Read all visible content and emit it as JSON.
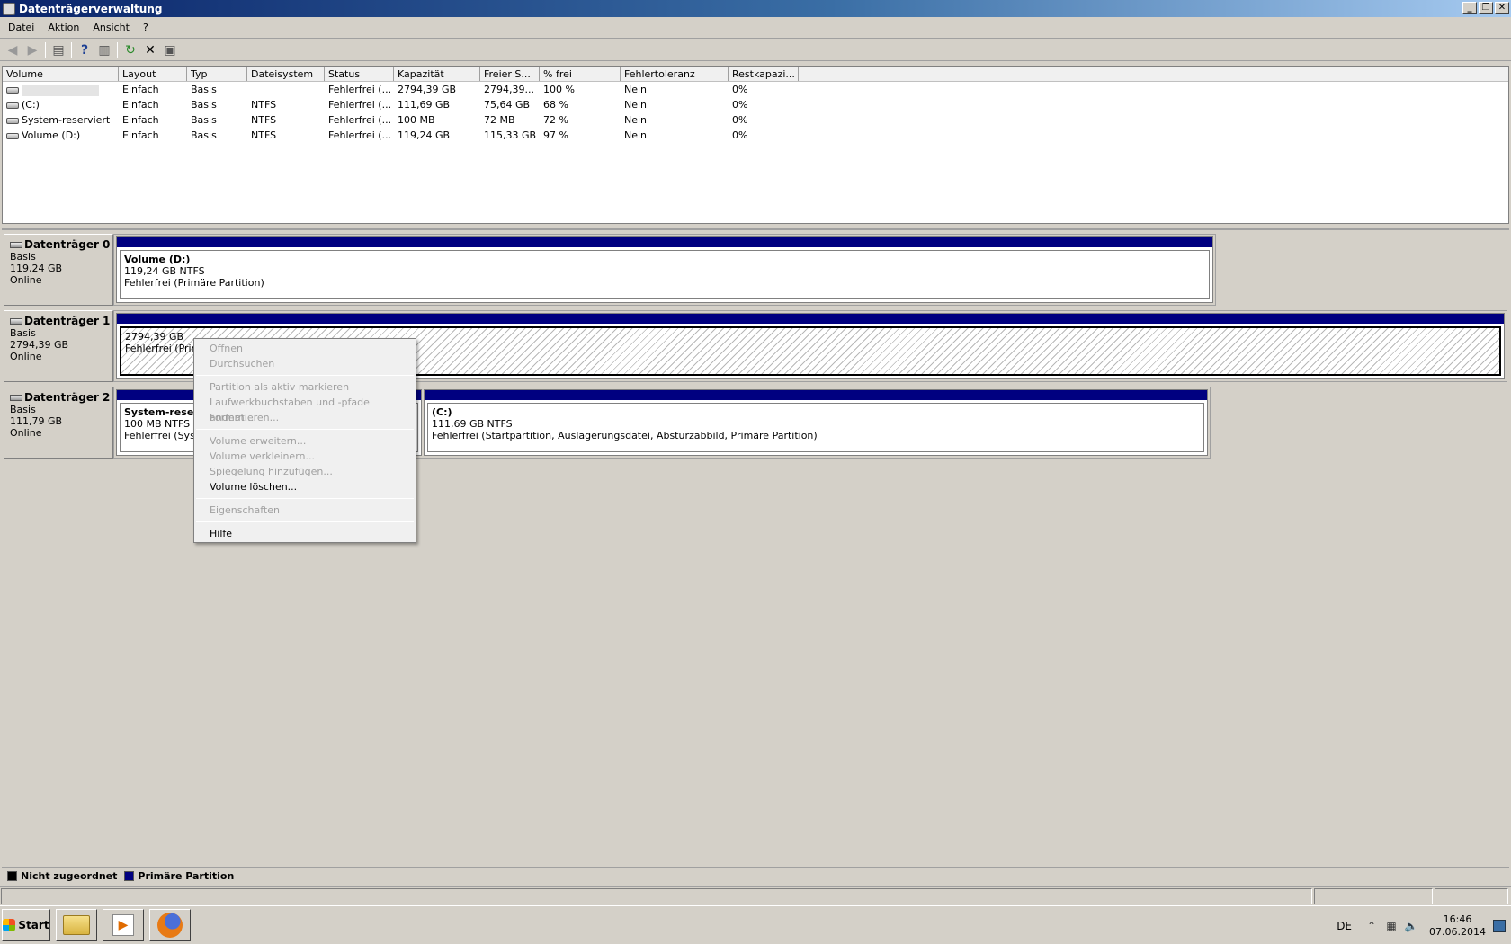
{
  "window": {
    "title": "Datenträgerverwaltung",
    "controls": [
      "_",
      "❐",
      "✕"
    ]
  },
  "menu": [
    "Datei",
    "Aktion",
    "Ansicht",
    "?"
  ],
  "toolbar": {
    "icons": [
      "back-icon",
      "forward-icon",
      "console-tree-icon",
      "help-icon",
      "view-icon",
      "refresh-icon",
      "delete-icon",
      "properties-icon"
    ]
  },
  "volume_table": {
    "columns": [
      "Volume",
      "Layout",
      "Typ",
      "Dateisystem",
      "Status",
      "Kapazität",
      "Freier S...",
      "% frei",
      "Fehlertoleranz",
      "Restkapazi..."
    ],
    "rows": [
      [
        "",
        "Einfach",
        "Basis",
        "",
        "Fehlerfrei (...",
        "2794,39 GB",
        "2794,39...",
        "100 %",
        "Nein",
        "0%"
      ],
      [
        "(C:)",
        "Einfach",
        "Basis",
        "NTFS",
        "Fehlerfrei (...",
        "111,69 GB",
        "75,64 GB",
        "68 %",
        "Nein",
        "0%"
      ],
      [
        "System-reserviert",
        "Einfach",
        "Basis",
        "NTFS",
        "Fehlerfrei (...",
        "100 MB",
        "72 MB",
        "72 %",
        "Nein",
        "0%"
      ],
      [
        "Volume (D:)",
        "Einfach",
        "Basis",
        "NTFS",
        "Fehlerfrei (...",
        "119,24 GB",
        "115,33 GB",
        "97 %",
        "Nein",
        "0%"
      ]
    ]
  },
  "disks": [
    {
      "name": "Datenträger 0",
      "type": "Basis",
      "size": "119,24 GB",
      "state": "Online",
      "partitions": [
        {
          "name": "Volume  (D:)",
          "size": "119,24 GB NTFS",
          "status": "Fehlerfrei (Primäre Partition)"
        }
      ]
    },
    {
      "name": "Datenträger 1",
      "type": "Basis",
      "size": "2794,39 GB",
      "state": "Online",
      "partitions": [
        {
          "name": "",
          "size": "2794,39 GB",
          "status": "Fehlerfrei (Primä"
        }
      ]
    },
    {
      "name": "Datenträger 2",
      "type": "Basis",
      "size": "111,79 GB",
      "state": "Online",
      "partitions": [
        {
          "name": "System-reser",
          "size": "100 MB NTFS",
          "status": "Fehlerfrei (Syste"
        },
        {
          "name": "(C:)",
          "size": "111,69 GB NTFS",
          "status": "Fehlerfrei (Startpartition, Auslagerungsdatei, Absturzabbild, Primäre Partition)"
        }
      ]
    }
  ],
  "context_menu": {
    "items": [
      {
        "label": "Öffnen",
        "enabled": false
      },
      {
        "label": "Durchsuchen",
        "enabled": false
      },
      {
        "label": "Partition als aktiv markieren",
        "enabled": false
      },
      {
        "label": "Laufwerkbuchstaben und -pfade ändern...",
        "enabled": false
      },
      {
        "label": "Formatieren...",
        "enabled": false
      },
      {
        "label": "Volume erweitern...",
        "enabled": false
      },
      {
        "label": "Volume verkleinern...",
        "enabled": false
      },
      {
        "label": "Spiegelung hinzufügen...",
        "enabled": false
      },
      {
        "label": "Volume löschen...",
        "enabled": true
      },
      {
        "label": "Eigenschaften",
        "enabled": false
      },
      {
        "label": "Hilfe",
        "enabled": true
      }
    ]
  },
  "legend": [
    {
      "label": "Nicht zugeordnet",
      "color": "#000000"
    },
    {
      "label": "Primäre Partition",
      "color": "#000080"
    }
  ],
  "taskbar": {
    "start_label": "Start",
    "apps": [
      "explorer-icon",
      "media-player-icon",
      "firefox-icon"
    ],
    "language": "DE",
    "time": "16:46",
    "date": "07.06.2014"
  },
  "colors": {
    "partition_bar": "#000080",
    "window_bg": "#d4d0c8"
  }
}
